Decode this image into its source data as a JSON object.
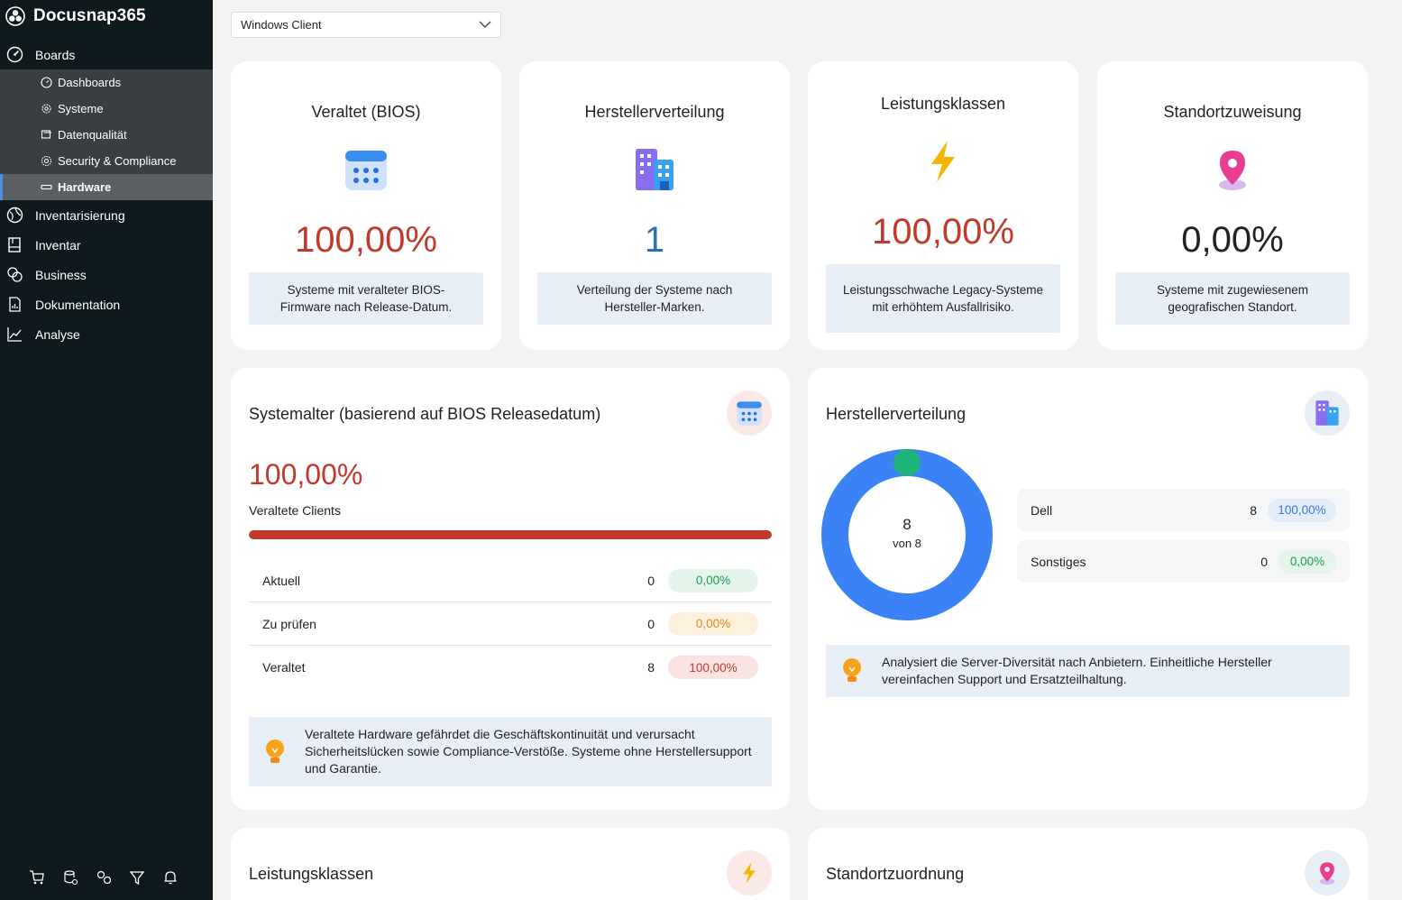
{
  "sidebar": {
    "brand": "Docusnap365",
    "boards_label": "Boards",
    "sub_items": [
      "Dashboards",
      "Systeme",
      "Datenqualität",
      "Security & Compliance",
      "Hardware"
    ],
    "active_sub": "Hardware",
    "items": [
      "Inventarisierung",
      "Inventar",
      "Business",
      "Dokumentation",
      "Analyse"
    ]
  },
  "filter": {
    "selected": "Windows Client"
  },
  "kpis": [
    {
      "title": "Veraltet (BIOS)",
      "value": "100,00%",
      "desc": "Systeme mit veralteter BIOS-Firmware nach Release-Datum.",
      "color": "#c0392b"
    },
    {
      "title": "Herstellerverteilung",
      "value": "1",
      "desc": "Verteilung der Systeme nach Hersteller-Marken.",
      "color": "#2f6fb3"
    },
    {
      "title": "Leistungsklassen",
      "value": "100,00%",
      "desc": "Leistungsschwache Legacy-Systeme mit erhöhtem Ausfallrisiko.",
      "color": "#c0392b"
    },
    {
      "title": "Standortzuweisung",
      "value": "0,00%",
      "desc": "Systeme mit zugewiesenem geografischen Standort.",
      "color": "#222222"
    }
  ],
  "systemalter": {
    "title": "Systemalter (basierend auf BIOS Releasedatum)",
    "value": "100,00%",
    "label": "Veraltete Clients",
    "progress": 1.0,
    "rows": [
      {
        "name": "Aktuell",
        "count": "0",
        "pct": "0,00%"
      },
      {
        "name": "Zu prüfen",
        "count": "0",
        "pct": "0,00%"
      },
      {
        "name": "Veraltet",
        "count": "8",
        "pct": "100,00%"
      }
    ],
    "hint": "Veraltete Hardware gefährdet die Geschäftskontinuität und verursacht Sicherheitslücken sowie Compliance-Verstöße. Systeme ohne Herstellersupport und Garantie."
  },
  "hersteller": {
    "title": "Herstellerverteilung",
    "center_value": "8",
    "center_label": "von 8",
    "rows": [
      {
        "name": "Dell",
        "count": "8",
        "pct": "100,00%",
        "share": 1.0
      },
      {
        "name": "Sonstiges",
        "count": "0",
        "pct": "0,00%",
        "share": 0.0
      }
    ],
    "hint": "Analysiert die Server-Diversität nach Anbietern. Einheitliche Hersteller vereinfachen Support und Ersatzteilhaltung."
  },
  "bottom": {
    "left_title": "Leistungsklassen",
    "right_title": "Standortzuordnung"
  },
  "colors": {
    "danger": "#c0392b",
    "blue": "#3b82f6",
    "green": "#1fb57a",
    "sidebar": "#0f1a1f"
  }
}
